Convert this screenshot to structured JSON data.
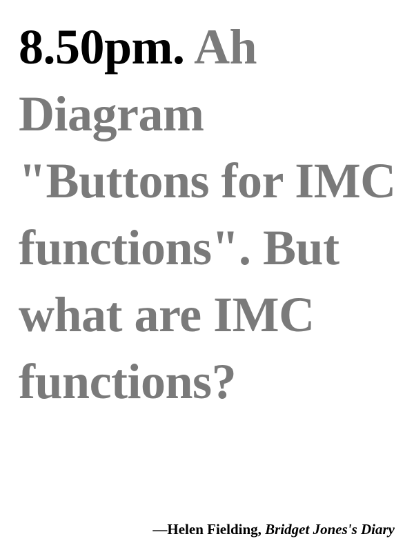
{
  "quote": {
    "time": "8.50pm.",
    "text": "Ah Diagram \"Buttons for IMC functions\". But what are IMC functions?"
  },
  "attribution": {
    "prefix": "—",
    "author": "Helen Fielding",
    "separator": ", ",
    "title": "Bridget Jones's Diary"
  },
  "colors": {
    "time": "#000000",
    "quote_text": "#7a7a7a",
    "attribution": "#000000",
    "background": "#ffffff"
  }
}
